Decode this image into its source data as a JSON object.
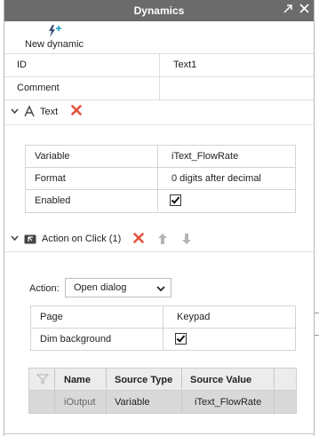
{
  "window": {
    "title": "Dynamics",
    "pin_glyph": "⇱",
    "close_glyph": "✕"
  },
  "toolbar": {
    "new_dynamic_label": "New dynamic",
    "new_dynamic_icon": "lightning-plus-icon"
  },
  "properties": [
    {
      "key": "ID",
      "value": "Text1"
    },
    {
      "key": "Comment",
      "value": ""
    }
  ],
  "text_section": {
    "title": "Text",
    "rows": [
      {
        "key": "Variable",
        "value": "iText_FlowRate"
      },
      {
        "key": "Format",
        "value": "0 digits after decimal"
      },
      {
        "key": "Enabled",
        "checked": true
      }
    ]
  },
  "action_section": {
    "title": "Action on Click (1)",
    "action_label": "Action:",
    "action_value": "Open dialog",
    "rows": [
      {
        "key": "Page",
        "value": "Keypad"
      },
      {
        "key": "Dim background",
        "checked": true
      }
    ],
    "params": {
      "headers": [
        "Name",
        "Source Type",
        "Source Value"
      ],
      "rows": [
        {
          "name": "iOutput",
          "source_type": "Variable",
          "source_value": "iText_FlowRate"
        }
      ]
    }
  },
  "icons": {
    "chevron": "chevron-down-icon",
    "text": "text-A-icon",
    "action": "action-click-icon",
    "delete": "close-x-icon",
    "up": "arrow-up-icon",
    "down": "arrow-down-icon"
  },
  "colors": {
    "titlebar": "#6b6b6b",
    "delete_red": "#e2533a",
    "disabled_arrow": "#b5b5b5",
    "selected_row": "#d9d9d9"
  },
  "glyphs": {
    "chevron": "❯",
    "delete": "✖",
    "up": "🡅",
    "down": "🡇",
    "dropdown": "⌄"
  }
}
